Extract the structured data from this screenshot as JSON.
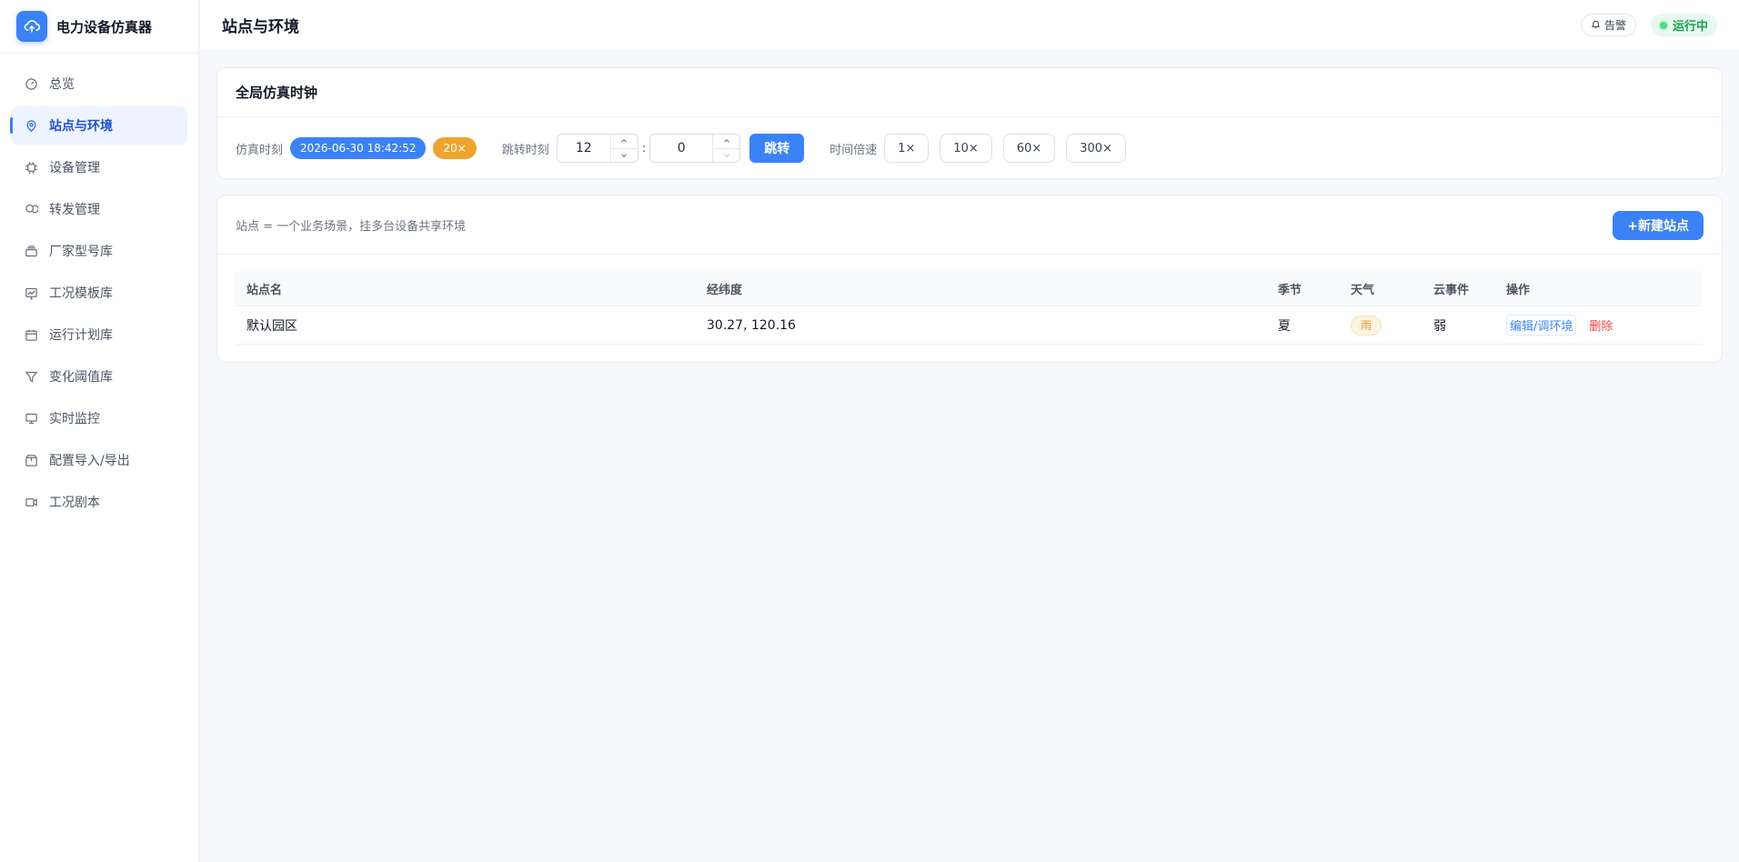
{
  "app": {
    "title": "电力设备仿真器",
    "page_title": "站点与环境"
  },
  "header": {
    "alarm_label": "告警",
    "status_label": "运行中"
  },
  "sidebar": {
    "items": [
      {
        "label": "总览",
        "icon": "gauge-icon"
      },
      {
        "label": "站点与环境",
        "icon": "map-pin-icon",
        "active": true
      },
      {
        "label": "设备管理",
        "icon": "chip-icon"
      },
      {
        "label": "转发管理",
        "icon": "forward-icon"
      },
      {
        "label": "厂家型号库",
        "icon": "layers-icon"
      },
      {
        "label": "工况模板库",
        "icon": "chart-icon"
      },
      {
        "label": "运行计划库",
        "icon": "calendar-icon"
      },
      {
        "label": "变化阈值库",
        "icon": "filter-icon"
      },
      {
        "label": "实时监控",
        "icon": "monitor-icon"
      },
      {
        "label": "配置导入/导出",
        "icon": "package-icon"
      },
      {
        "label": "工况剧本",
        "icon": "video-icon"
      }
    ]
  },
  "clock": {
    "title": "全局仿真时钟",
    "sim_time_label": "仿真时刻",
    "sim_time_value": "2026-06-30 18:42:52",
    "speed_badge": "20×",
    "jump_label": "跳转时刻",
    "jump_hour": "12",
    "jump_minute": "0",
    "colon": ":",
    "jump_button": "跳转",
    "rate_label": "时间倍速",
    "rates": [
      "1×",
      "10×",
      "60×",
      "300×"
    ]
  },
  "sites": {
    "description": "站点 = 一个业务场景，挂多台设备共享环境",
    "new_button": "+新建站点",
    "columns": [
      "站点名",
      "经纬度",
      "季节",
      "天气",
      "云事件",
      "操作"
    ],
    "rows": [
      {
        "name": "默认园区",
        "coords": "30.27, 120.16",
        "season": "夏",
        "weather": "雨",
        "cloud_event": "弱",
        "edit_label": "编辑/调环境",
        "delete_label": "删除"
      }
    ]
  },
  "colors": {
    "accent": "#3b82f6",
    "speed_badge": "#f0a32f",
    "status_green": "#16a34a",
    "danger": "#ef4444"
  }
}
